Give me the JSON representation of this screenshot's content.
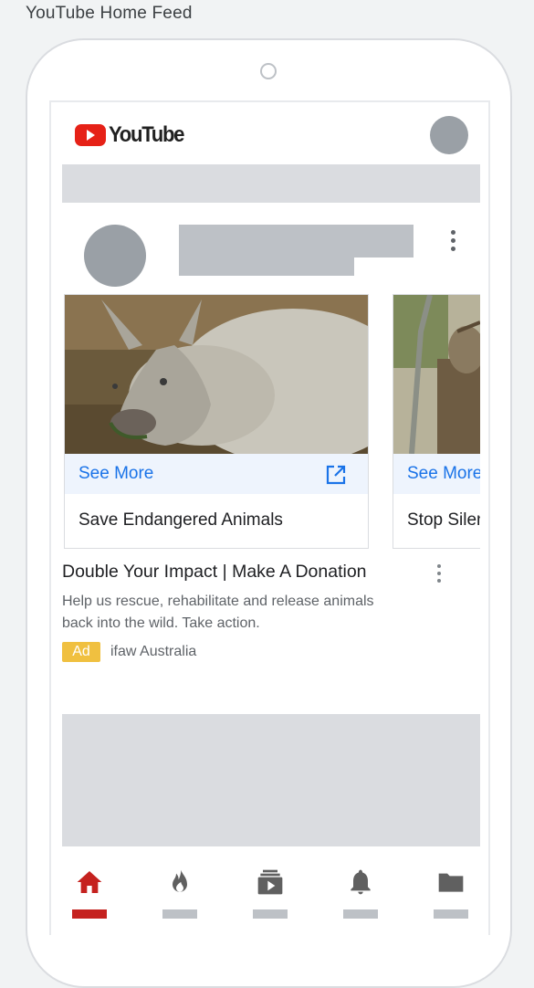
{
  "page_title": "YouTube Home Feed",
  "header": {
    "logo_text": "YouTube"
  },
  "cards": [
    {
      "cta_label": "See More",
      "title": "Save Endangered Animals",
      "image": "rhinoceros-photo"
    },
    {
      "cta_label": "See More",
      "title": "Stop Silencing",
      "image": "giraffe-photo"
    }
  ],
  "ad": {
    "title": "Double Your Impact | Make A Donation",
    "description": "Help us rescue, rehabilitate and release animals back into the wild. Take action.",
    "badge": "Ad",
    "advertiser": "ifaw Australia"
  },
  "bottom_nav": {
    "items": [
      {
        "icon": "home-icon",
        "active": true
      },
      {
        "icon": "trending-icon",
        "active": false
      },
      {
        "icon": "subscriptions-icon",
        "active": false
      },
      {
        "icon": "notifications-icon",
        "active": false
      },
      {
        "icon": "library-icon",
        "active": false
      }
    ]
  },
  "colors": {
    "brand_red": "#e62117",
    "link_blue": "#1a73e8",
    "ad_badge": "#f0c040",
    "active_nav": "#c5221f"
  }
}
